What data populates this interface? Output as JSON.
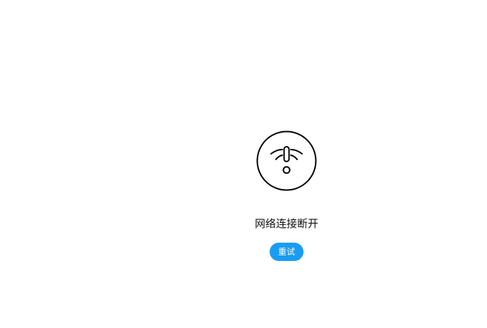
{
  "error": {
    "icon": "wifi-disconnected-icon",
    "message": "网络连接断开"
  },
  "actions": {
    "retry_label": "重试"
  },
  "colors": {
    "background": "#ffffff",
    "icon_stroke": "#000000",
    "button_background": "#1a9cf3",
    "button_text": "#ffffff"
  }
}
